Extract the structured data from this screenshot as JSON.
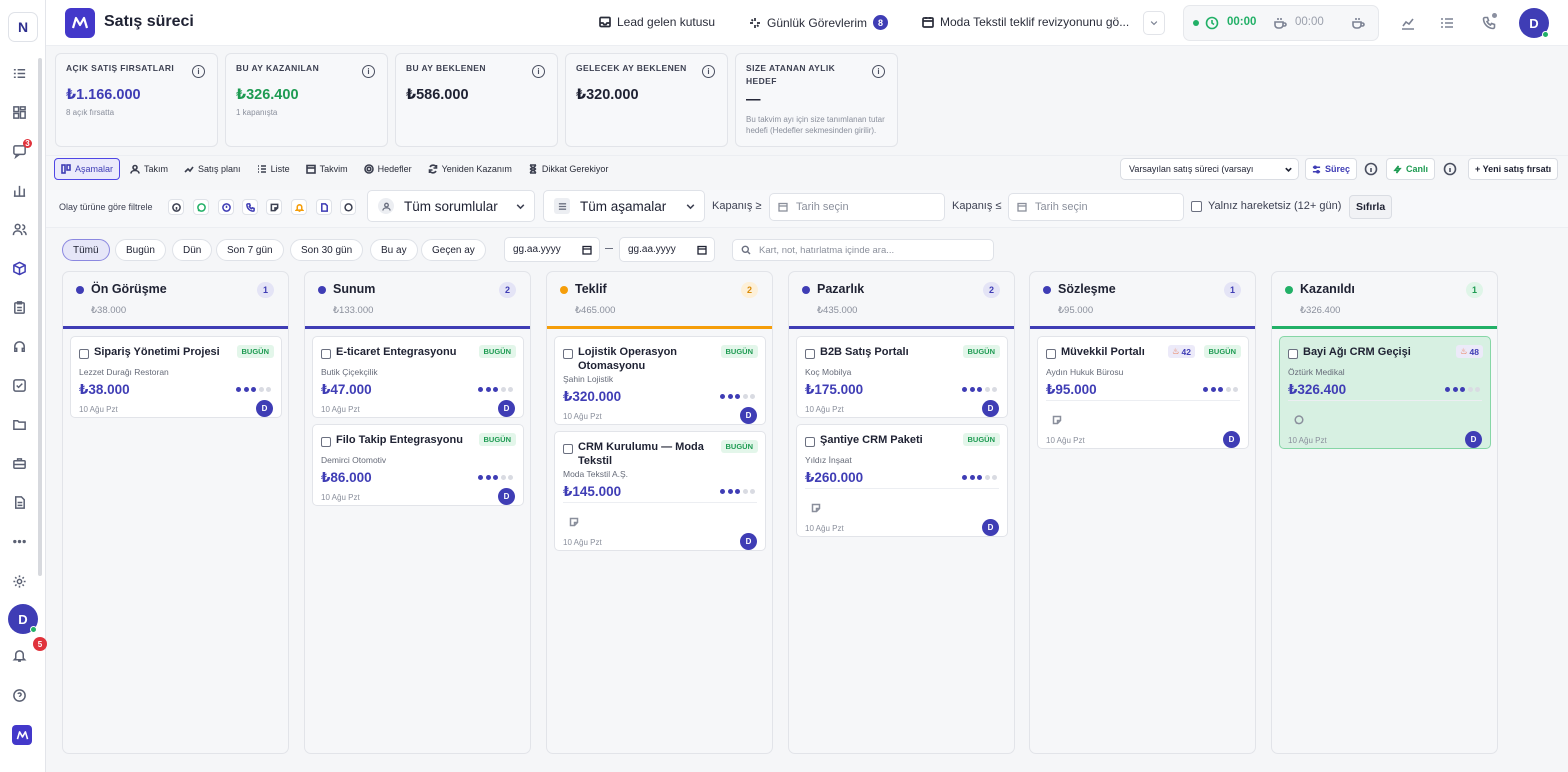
{
  "sidebar": {
    "workspace_initial": "N",
    "chat_badge": "3",
    "user_initial": "D",
    "notif_badge": "5",
    "icons": [
      "tasks-icon",
      "dashboard-icon",
      "chat-icon",
      "chart-icon",
      "users-icon",
      "cube-icon",
      "clipboard-icon",
      "headset-icon",
      "checklist-icon",
      "folder-icon",
      "briefcase-icon",
      "document-icon",
      "more-icon",
      "settings-icon"
    ]
  },
  "topbar": {
    "title": "Satış süreci",
    "lead_inbox": "Lead gelen kutusu",
    "daily_tasks": "Günlük Görevlerim",
    "daily_tasks_count": "8",
    "event": "Moda Tekstil teklif revizyonunu gö...",
    "timer1": "00:00",
    "timer2": "00:00",
    "user_initial": "D"
  },
  "kpis": [
    {
      "label": "AÇIK SATIŞ FIRSATLARI",
      "value": "₺1.166.000",
      "sub": "8 açık fırsatta",
      "color": "#3f3db5"
    },
    {
      "label": "BU AY KAZANILAN",
      "value": "₺326.400",
      "sub": "1 kapanışta",
      "color": "#1e9b52"
    },
    {
      "label": "BU AY BEKLENEN",
      "value": "₺586.000",
      "sub": "",
      "color": "#1f2233"
    },
    {
      "label": "GELECEK AY BEKLENEN",
      "value": "₺320.000",
      "sub": "",
      "color": "#1f2233"
    },
    {
      "label": "SIZE ATANAN AYLIK HEDEF",
      "value": "—",
      "sub": "Bu takvim ayı için size tanımlanan tutar hedefi (Hedefler sekmesinden girilir).",
      "color": "#1f2233"
    }
  ],
  "views": {
    "tabs": [
      "Aşamalar",
      "Takım",
      "Satış planı",
      "Liste",
      "Takvim",
      "Hedefler",
      "Yeniden Kazanım",
      "Dikkat Gerekiyor"
    ],
    "active": "Aşamalar",
    "pipeline_select": "Varsayılan satış süreci (varsayı",
    "process_btn": "Süreç",
    "live_btn": "Canlı",
    "new_btn": "+ Yeni satış fırsatı"
  },
  "filters": {
    "event_label": "Olay türüne göre filtrele",
    "owners": "Tüm sorumlular",
    "stages": "Tüm aşamalar",
    "close_gte": "Kapanış ≥",
    "close_lte": "Kapanış ≤",
    "date_placeholder": "Tarih seçin",
    "inactive_only": "Yalnız hareketsiz (12+ gün)",
    "reset": "Sıfırla"
  },
  "chips": [
    "Tümü",
    "Bugün",
    "Dün",
    "Son 7 gün",
    "Son 30 gün",
    "Bu ay",
    "Geçen ay"
  ],
  "date_range": {
    "from": "gg.aa.yyyy",
    "to": "gg.aa.yyyy"
  },
  "search_placeholder": "Kart, not, hatırlatma içinde ara...",
  "columns": [
    {
      "name": "Ön Görüşme",
      "count": "1",
      "total": "₺38.000",
      "color": "#3f3db5",
      "cards": [
        {
          "title": "Sipariş Yönetimi Projesi",
          "tag": "BUGÜN",
          "company": "Lezzet Durağı Restoran",
          "amount": "₺38.000",
          "stage_dots": 3,
          "date": "10 Ağu Pzt",
          "owner": "D"
        }
      ]
    },
    {
      "name": "Sunum",
      "count": "2",
      "total": "₺133.000",
      "color": "#3f3db5",
      "cards": [
        {
          "title": "E-ticaret Entegrasyonu",
          "tag": "BUGÜN",
          "company": "Butik Çiçekçilik",
          "amount": "₺47.000",
          "stage_dots": 3,
          "date": "10 Ağu Pzt",
          "owner": "D"
        },
        {
          "title": "Filo Takip Entegrasyonu",
          "tag": "BUGÜN",
          "company": "Demirci Otomotiv",
          "amount": "₺86.000",
          "stage_dots": 3,
          "date": "10 Ağu Pzt",
          "owner": "D"
        }
      ]
    },
    {
      "name": "Teklif",
      "count": "2",
      "total": "₺465.000",
      "color": "#f59e0b",
      "cards": [
        {
          "title": "Lojistik Operasyon Otomasyonu",
          "tag": "BUGÜN",
          "company": "Şahin Lojistik",
          "amount": "₺320.000",
          "stage_dots": 3,
          "date": "10 Ağu Pzt",
          "owner": "D"
        },
        {
          "title": "CRM Kurulumu — Moda Tekstil",
          "tag": "BUGÜN",
          "company": "Moda Tekstil A.Ş.",
          "amount": "₺145.000",
          "stage_dots": 3,
          "date": "10 Ağu Pzt",
          "owner": "D",
          "event": "note"
        }
      ]
    },
    {
      "name": "Pazarlık",
      "count": "2",
      "total": "₺435.000",
      "color": "#3f3db5",
      "cards": [
        {
          "title": "B2B Satış Portalı",
          "tag": "BUGÜN",
          "company": "Koç Mobilya",
          "amount": "₺175.000",
          "stage_dots": 3,
          "date": "10 Ağu Pzt",
          "owner": "D"
        },
        {
          "title": "Şantiye CRM Paketi",
          "tag": "BUGÜN",
          "company": "Yıldız İnşaat",
          "amount": "₺260.000",
          "stage_dots": 3,
          "date": "10 Ağu Pzt",
          "owner": "D",
          "event": "note"
        }
      ]
    },
    {
      "name": "Sözleşme",
      "count": "1",
      "total": "₺95.000",
      "color": "#3f3db5",
      "cards": [
        {
          "title": "Müvekkil Portalı",
          "tag": "BUGÜN",
          "hot": "42",
          "company": "Aydın Hukuk Bürosu",
          "amount": "₺95.000",
          "stage_dots": 3,
          "date": "10 Ağu Pzt",
          "owner": "D",
          "event": "note"
        }
      ]
    },
    {
      "name": "Kazanıldı",
      "count": "1",
      "total": "₺326.400",
      "color": "#22b067",
      "cards": [
        {
          "title": "Bayi Ağı CRM Geçişi",
          "hot": "48",
          "company": "Öztürk Medikal",
          "amount": "₺326.400",
          "stage_dots": 3,
          "date": "10 Ağu Pzt",
          "owner": "D",
          "event": "chat",
          "won": true
        }
      ]
    }
  ]
}
